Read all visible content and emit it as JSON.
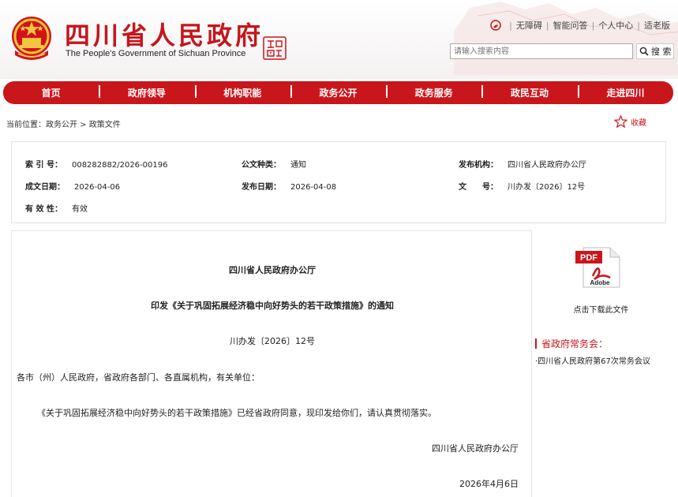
{
  "header": {
    "title_cn": "四川省人民政府",
    "title_en": "The People's Government of Sichuan Province",
    "seal_text": "中國",
    "links": [
      "无障碍",
      "智能问答",
      "个人中心",
      "适老版"
    ],
    "search_placeholder": "请输入搜索内容",
    "search_button": "搜 索"
  },
  "nav": [
    "首页",
    "政府领导",
    "机构职能",
    "政务公开",
    "政务服务",
    "政民互动",
    "走进四川"
  ],
  "breadcrumb": {
    "label": "当前位置：",
    "items": [
      "政务公开",
      "政策文件"
    ],
    "separator": " > "
  },
  "favorite_label": "收藏",
  "meta": {
    "index_label": "索 引 号：",
    "index_value": "008282882/2026-00196",
    "type_label": "公文种类：",
    "type_value": "通知",
    "issuer_label": "发布机构：",
    "issuer_value": "四川省人民政府办公厅",
    "created_label": "成文日期：",
    "created_value": "2026-04-06",
    "published_label": "发布日期：",
    "published_value": "2026-04-08",
    "docno_label": "文　　号：",
    "docno_value": "川办发〔2026〕12号",
    "validity_label": "有 效 性：",
    "validity_value": "有效"
  },
  "document": {
    "org": "四川省人民政府办公厅",
    "title": "印发《关于巩固拓展经济稳中向好势头的若干政策措施》的通知",
    "number": "川办发〔2026〕12号",
    "recipients": "各市（州）人民政府，省政府各部门、各直属机构，有关单位：",
    "body": "《关于巩固拓展经济稳中向好势头的若干政策措施》已经省政府同意，现印发给你们，请认真贯彻落实。",
    "signature": "四川省人民政府办公厅",
    "date": "2026年4月6日"
  },
  "side": {
    "pdf_label": "PDF",
    "adobe_label": "Adobe",
    "download_label": "点击下载此文件",
    "section_title": "省政府常务会：",
    "meeting_link": "·四川省人民政府第67次常务会议"
  },
  "colors": {
    "brand_red": "#c9161b"
  }
}
